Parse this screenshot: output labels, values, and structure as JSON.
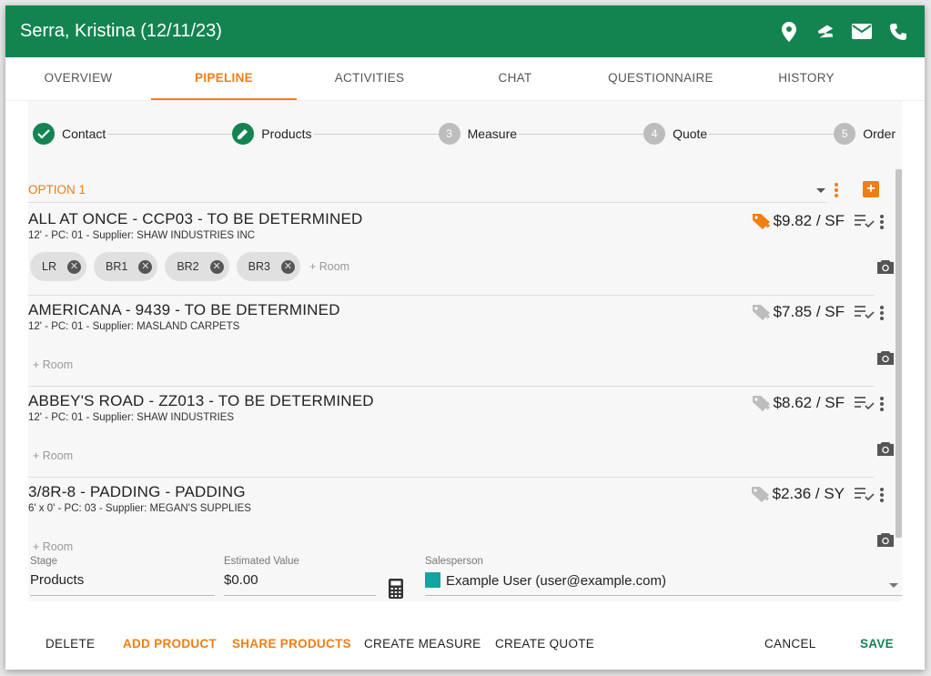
{
  "header": {
    "title": "Serra, Kristina (12/11/23)"
  },
  "tabs": [
    "OVERVIEW",
    "PIPELINE",
    "ACTIVITIES",
    "CHAT",
    "QUESTIONNAIRE",
    "HISTORY"
  ],
  "active_tab": "PIPELINE",
  "steps": [
    {
      "num": "",
      "label": "Contact",
      "state": "done"
    },
    {
      "num": "",
      "label": "Products",
      "state": "current"
    },
    {
      "num": "3",
      "label": "Measure",
      "state": "todo"
    },
    {
      "num": "4",
      "label": "Quote",
      "state": "todo"
    },
    {
      "num": "5",
      "label": "Order",
      "state": "todo"
    }
  ],
  "option": {
    "label": "OPTION 1"
  },
  "products": [
    {
      "name": "ALL AT ONCE - CCP03 - TO BE DETERMINED",
      "sub": "12' - PC: 01 - Supplier: SHAW INDUSTRIES INC",
      "price": "$9.82 / SF",
      "tag_active": true,
      "rooms": [
        "LR",
        "BR1",
        "BR2",
        "BR3"
      ],
      "add_room": "+ Room"
    },
    {
      "name": "AMERICANA - 9439 - TO BE DETERMINED",
      "sub": "12' - PC: 01 - Supplier: MASLAND CARPETS",
      "price": "$7.85 / SF",
      "tag_active": false,
      "rooms": [],
      "add_room": "+ Room"
    },
    {
      "name": "ABBEY'S ROAD - ZZ013 - TO BE DETERMINED",
      "sub": "12' - PC: 01 - Supplier: SHAW INDUSTRIES",
      "price": "$8.62 / SF",
      "tag_active": false,
      "rooms": [],
      "add_room": "+ Room"
    },
    {
      "name": "3/8R-8 - PADDING - PADDING",
      "sub": "6' x 0' - PC: 03 - Supplier: MEGAN'S SUPPLIES",
      "price": "$2.36 / SY",
      "tag_active": false,
      "rooms": [],
      "add_room": "+ Room"
    }
  ],
  "fields": {
    "stage": {
      "label": "Stage",
      "value": "Products"
    },
    "estimated_value": {
      "label": "Estimated Value",
      "value": "$0.00"
    },
    "salesperson": {
      "label": "Salesperson",
      "value": "Example User (user@example.com)",
      "color": "#13a3a3"
    }
  },
  "actions": {
    "delete": "DELETE",
    "add_product": "ADD PRODUCT",
    "share_products": "SHARE PRODUCTS",
    "create_measure": "CREATE MEASURE",
    "create_quote": "CREATE QUOTE",
    "cancel": "CANCEL",
    "save": "SAVE"
  },
  "colors": {
    "header": "#138450",
    "accent": "#f07e13",
    "done": "#138450",
    "todo": "#bdbdbd"
  }
}
